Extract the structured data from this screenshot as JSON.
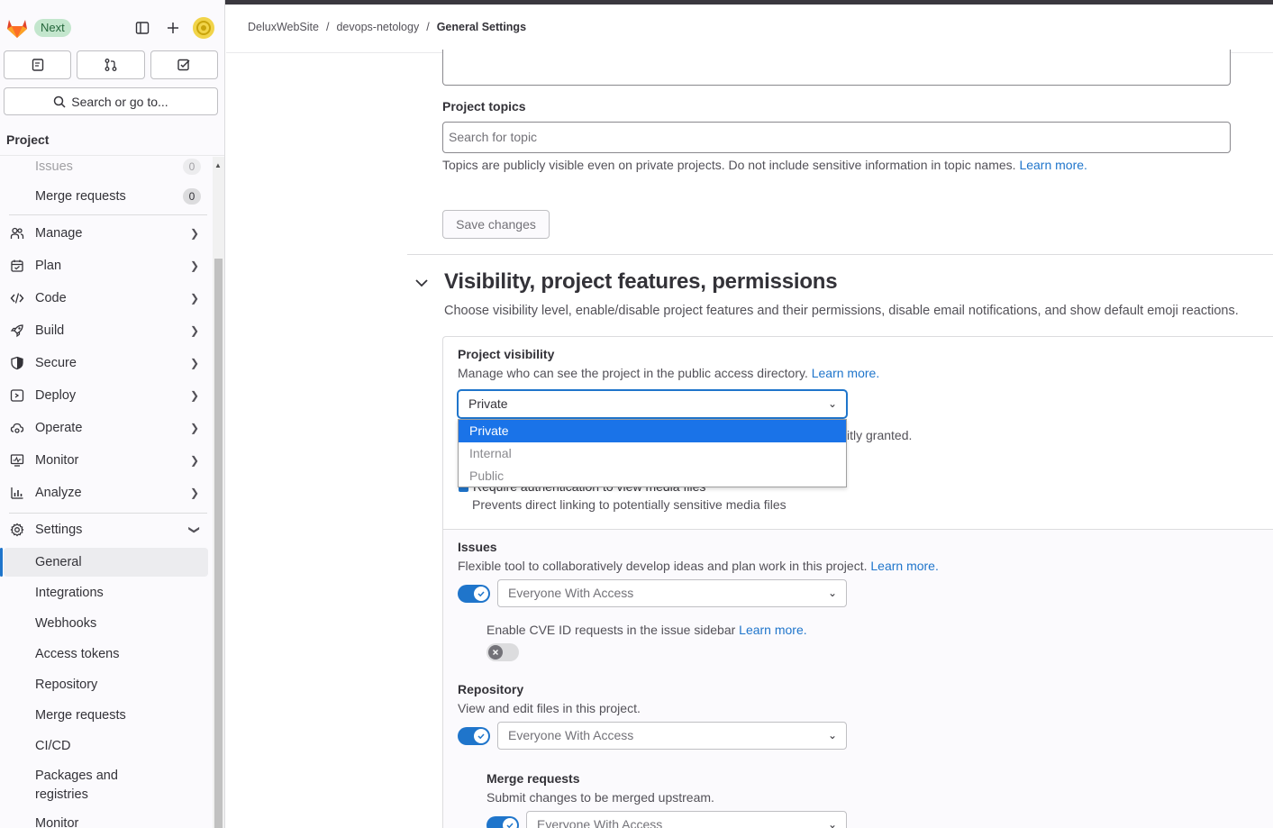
{
  "sidebar": {
    "badge": "Next",
    "search_label": "Search or go to...",
    "project_heading": "Project",
    "items": [
      {
        "label": "Issues",
        "count": "0"
      },
      {
        "label": "Merge requests",
        "count": "0"
      },
      {
        "label": "Manage"
      },
      {
        "label": "Plan"
      },
      {
        "label": "Code"
      },
      {
        "label": "Build"
      },
      {
        "label": "Secure"
      },
      {
        "label": "Deploy"
      },
      {
        "label": "Operate"
      },
      {
        "label": "Monitor"
      },
      {
        "label": "Analyze"
      },
      {
        "label": "Settings"
      }
    ],
    "settings_items": [
      {
        "label": "General"
      },
      {
        "label": "Integrations"
      },
      {
        "label": "Webhooks"
      },
      {
        "label": "Access tokens"
      },
      {
        "label": "Repository"
      },
      {
        "label": "Merge requests"
      },
      {
        "label": "CI/CD"
      },
      {
        "label": "Packages and"
      },
      {
        "label": "registries"
      },
      {
        "label": "Monitor"
      }
    ]
  },
  "breadcrumb": {
    "items": [
      "DeluxWebSite",
      "devops-netology",
      "General Settings"
    ],
    "sep": "/"
  },
  "topics": {
    "label": "Project topics",
    "placeholder": "Search for topic",
    "help": "Topics are publicly visible even on private projects. Do not include sensitive information in topic names.",
    "learn_more": "Learn more."
  },
  "save_button": "Save changes",
  "section": {
    "title": "Visibility, project features, permissions",
    "description": "Choose visibility level, enable/disable project features and their permissions, disable email notifications, and show default emoji reactions."
  },
  "visibility": {
    "label": "Project visibility",
    "help": "Manage who can see the project in the public access directory.",
    "learn_more": "Learn more.",
    "selected": "Private",
    "options": [
      "Private",
      "Internal",
      "Public"
    ],
    "hidden_help_tail": "itly granted.",
    "media_checkbox_label": "Require authentication to view media files",
    "media_help": "Prevents direct linking to potentially sensitive media files"
  },
  "issues": {
    "label": "Issues",
    "help": "Flexible tool to collaboratively develop ideas and plan work in this project.",
    "learn_more": "Learn more.",
    "access": "Everyone With Access",
    "cve_label": "Enable CVE ID requests in the issue sidebar",
    "cve_learn_more": "Learn more."
  },
  "repository": {
    "label": "Repository",
    "help": "View and edit files in this project.",
    "access": "Everyone With Access"
  },
  "merge_requests": {
    "label": "Merge requests",
    "help": "Submit changes to be merged upstream.",
    "access": "Everyone With Access"
  },
  "colors": {
    "accent": "#1f75cb",
    "dropdown_selected": "#1a73e8",
    "badge_bg": "#c3e6cd"
  }
}
